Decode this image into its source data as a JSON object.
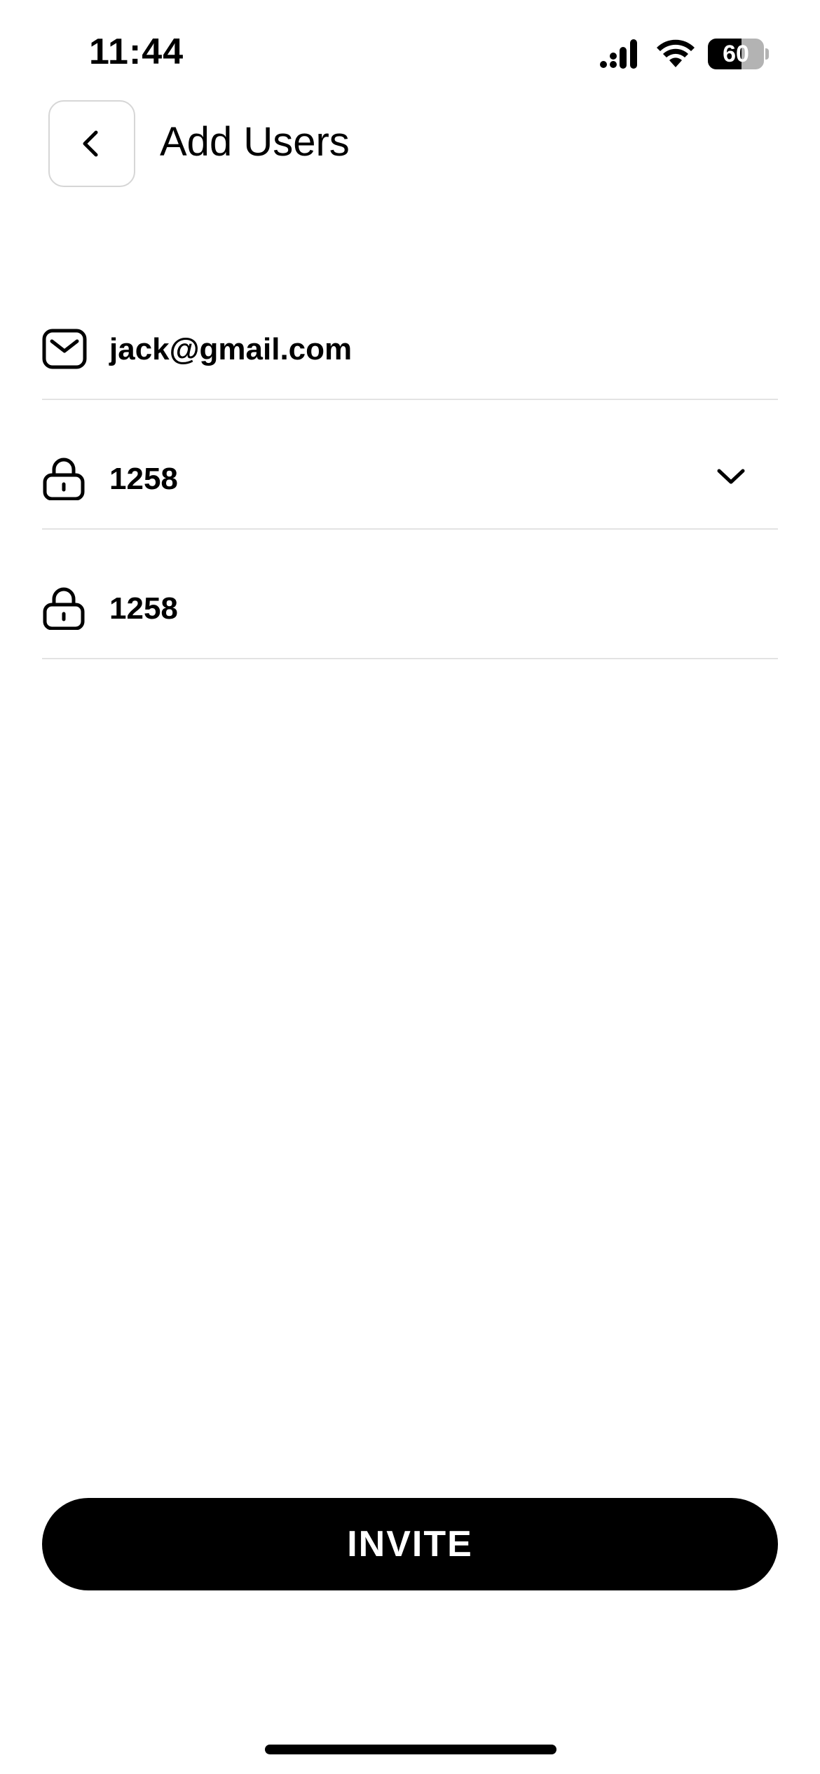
{
  "status_bar": {
    "time": "11:44",
    "battery_level": "60",
    "battery_fraction": 0.6,
    "icons": [
      "signal-icon",
      "wifi-icon",
      "battery-icon"
    ]
  },
  "header": {
    "back_icon": "chevron-left-icon",
    "title": "Add Users"
  },
  "form": {
    "email": {
      "icon": "mail-icon",
      "value": "jack@gmail.com"
    },
    "password": {
      "icon": "lock-icon",
      "value": "1258",
      "dropdown_icon": "chevron-down-icon"
    },
    "confirm_password": {
      "icon": "lock-icon",
      "value": "1258"
    }
  },
  "actions": {
    "invite_label": "INVITE"
  },
  "colors": {
    "primary": "#000000",
    "background": "#ffffff",
    "divider": "#e3e3e3",
    "border": "#d6d6d6"
  }
}
